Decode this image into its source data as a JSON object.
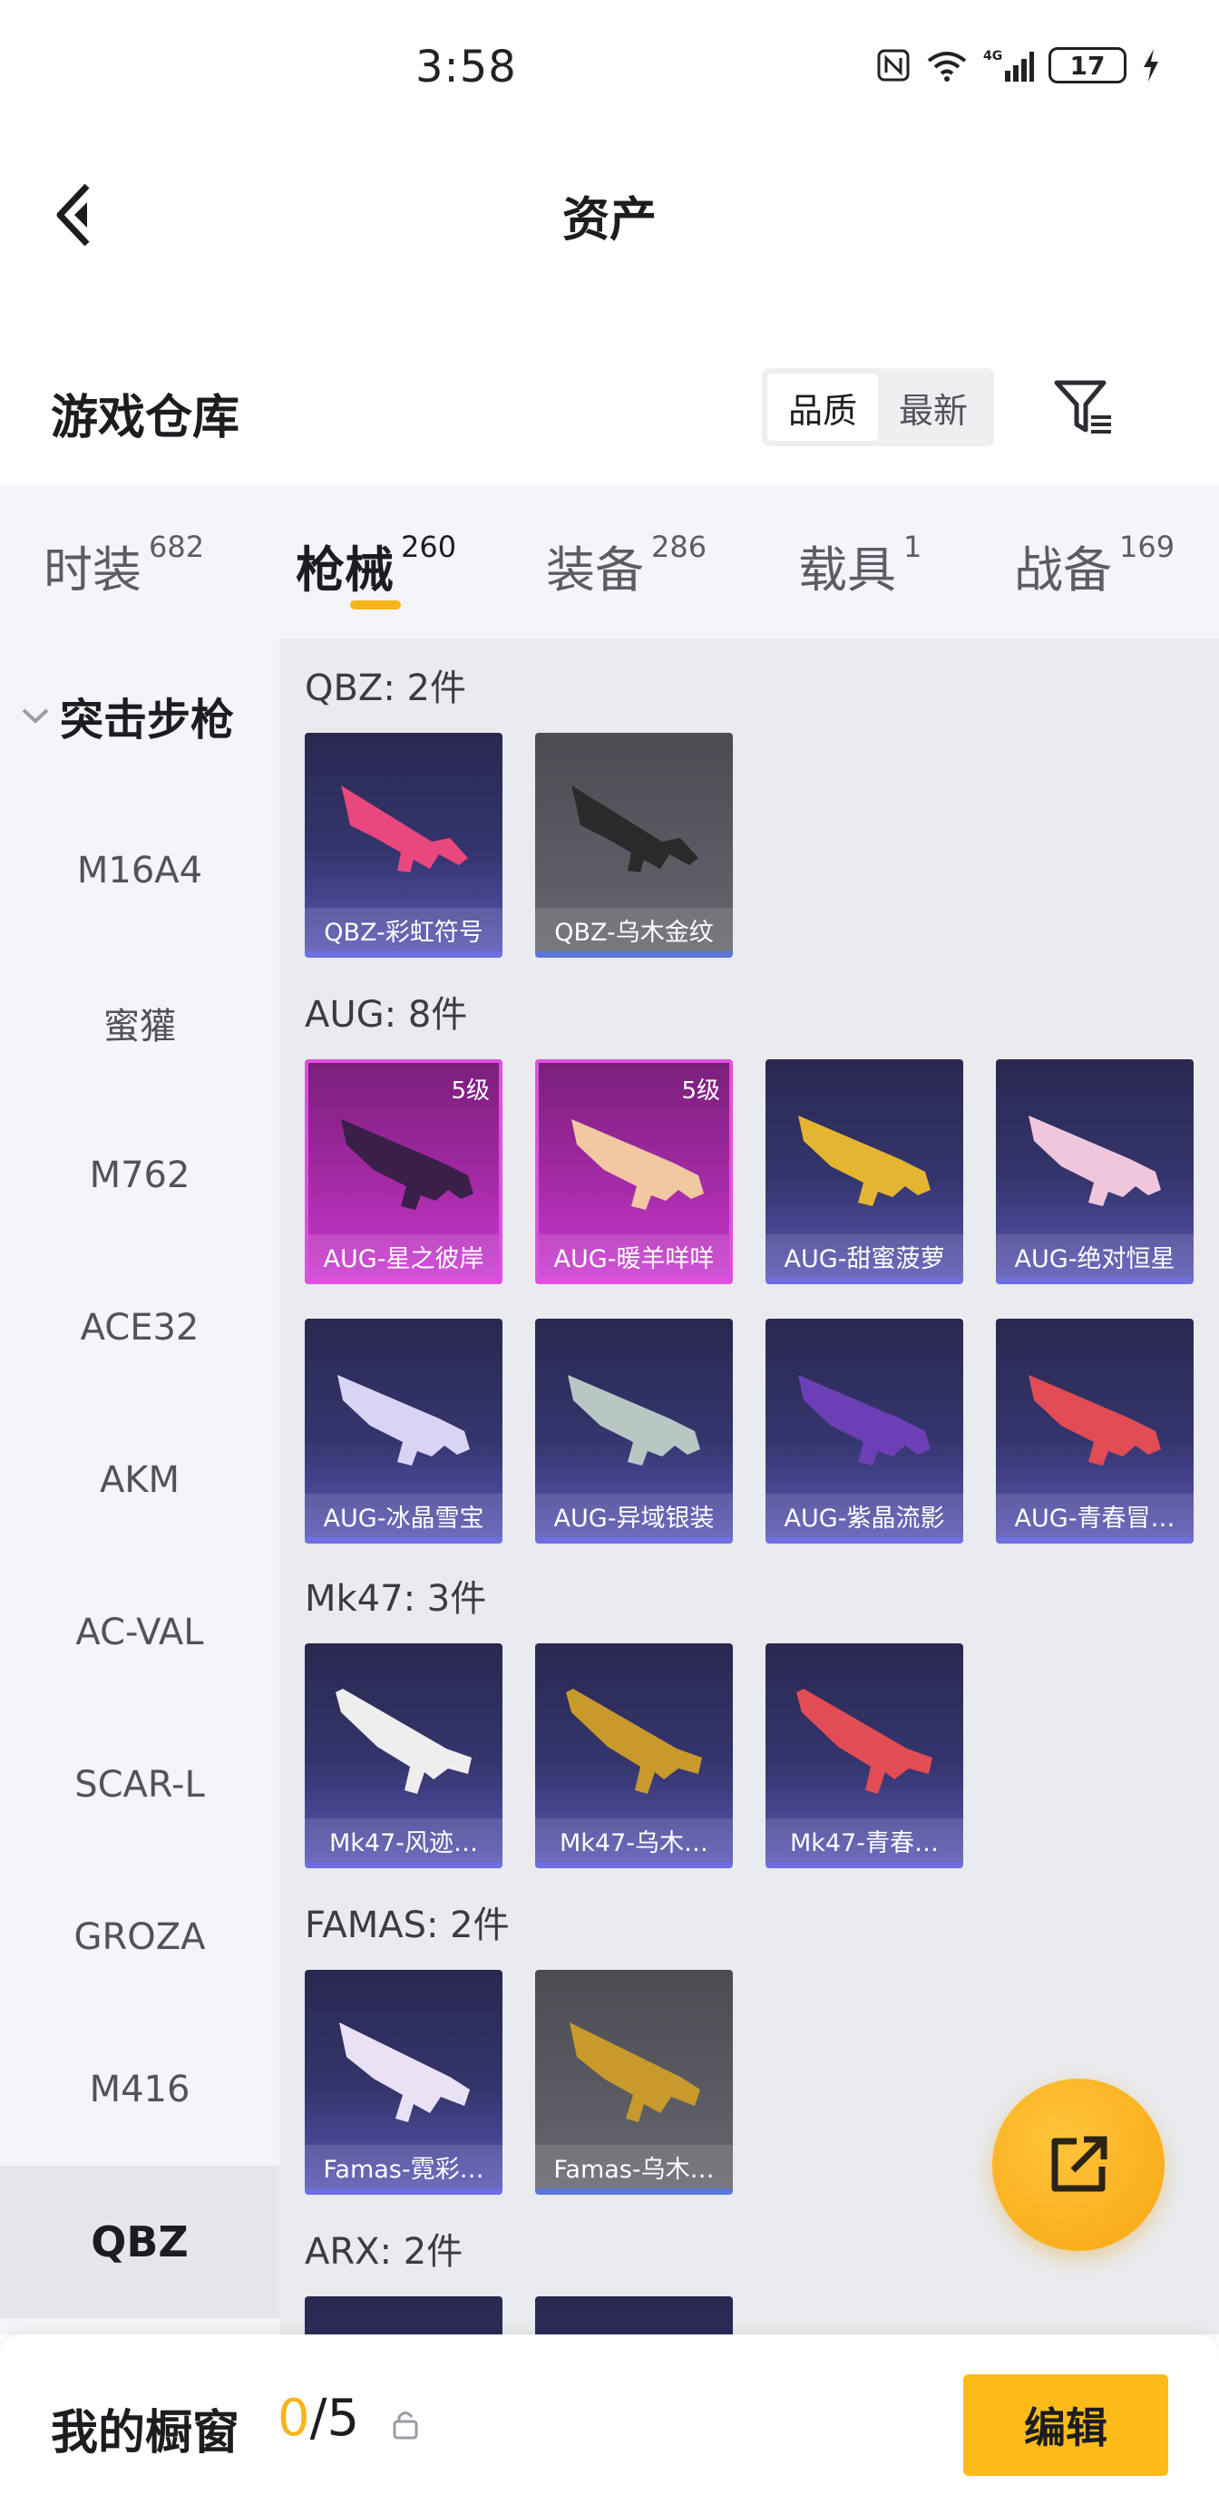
{
  "status_bar": {
    "time": "3:58",
    "battery": "17",
    "network": "4G"
  },
  "header": {
    "title": "资产"
  },
  "section": {
    "title": "游戏仓库",
    "sort_options": [
      "品质",
      "最新"
    ],
    "active_sort": "品质"
  },
  "tabs": [
    {
      "label": "时装",
      "count": "682"
    },
    {
      "label": "枪械",
      "count": "260",
      "active": true
    },
    {
      "label": "装备",
      "count": "286"
    },
    {
      "label": "载具",
      "count": "1"
    },
    {
      "label": "战备",
      "count": "169"
    }
  ],
  "sidebar": {
    "group_label": "突击步枪",
    "items": [
      "M16A4",
      "蜜獾",
      "M762",
      "ACE32",
      "AKM",
      "AC-VAL",
      "SCAR-L",
      "GROZA",
      "M416",
      "QBZ"
    ],
    "active_item": "QBZ"
  },
  "groups": [
    {
      "title": "QBZ: 2件",
      "items": [
        {
          "name": "QBZ-彩虹符号",
          "style": "blue",
          "gun_color": "#e8487e"
        },
        {
          "name": "QBZ-乌木金纹",
          "style": "grey",
          "gun_color": "#2a2a2a"
        }
      ]
    },
    {
      "title": "AUG: 8件",
      "items": [
        {
          "name": "AUG-星之彼岸",
          "style": "pink",
          "level": "5级",
          "gun_color": "#3a1f48"
        },
        {
          "name": "AUG-暖羊咩咩",
          "style": "pink",
          "level": "5级",
          "gun_color": "#f1c8a2"
        },
        {
          "name": "AUG-甜蜜菠萝",
          "style": "blue",
          "gun_color": "#e5b431"
        },
        {
          "name": "AUG-绝对恒星",
          "style": "blue",
          "gun_color": "#f0c6dc"
        },
        {
          "name": "AUG-冰晶雪宝",
          "style": "blue",
          "gun_color": "#d9d3f4"
        },
        {
          "name": "AUG-异域银装",
          "style": "blue",
          "gun_color": "#b8c7c4"
        },
        {
          "name": "AUG-紫晶流影",
          "style": "blue",
          "gun_color": "#6d3fb6"
        },
        {
          "name": "AUG-青春冒…",
          "style": "blue",
          "gun_color": "#e24c55"
        }
      ]
    },
    {
      "title": "Mk47: 3件",
      "items": [
        {
          "name": "Mk47-风迹…",
          "style": "blue",
          "gun_color": "#eeeeee"
        },
        {
          "name": "Mk47-乌木…",
          "style": "blue",
          "gun_color": "#c79a2b"
        },
        {
          "name": "Mk47-青春…",
          "style": "blue",
          "gun_color": "#e24c55"
        }
      ]
    },
    {
      "title": "FAMAS: 2件",
      "items": [
        {
          "name": "Famas-霓彩…",
          "style": "blue",
          "gun_color": "#e9e2f5"
        },
        {
          "name": "Famas-乌木…",
          "style": "grey",
          "gun_color": "#c79a2b"
        }
      ]
    },
    {
      "title": "ARX: 2件",
      "items": [
        {
          "name": "",
          "style": "blue",
          "gun_color": "#2a2850"
        },
        {
          "name": "",
          "style": "blue",
          "gun_color": "#2a2850"
        }
      ]
    }
  ],
  "showcase": {
    "label": "我的橱窗",
    "current": "0",
    "total": "/5",
    "edit_label": "编辑"
  },
  "colors": {
    "accent": "#f6b619",
    "card_blue": "#34356d",
    "card_pink": "#a42aa6"
  }
}
